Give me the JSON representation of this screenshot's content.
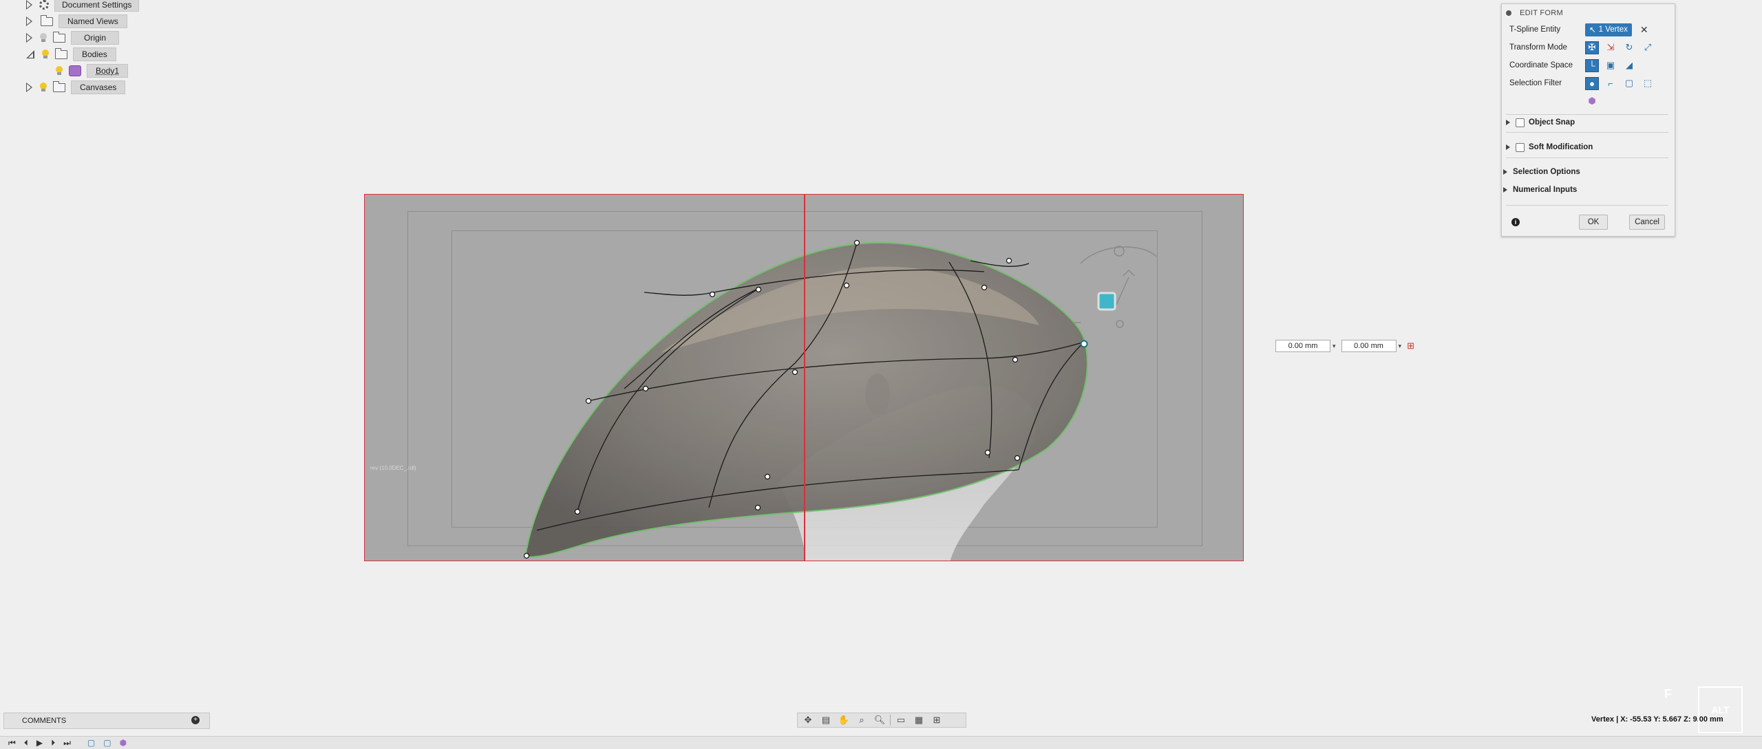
{
  "browser_tree": {
    "items": [
      {
        "label": "Document Settings",
        "icon": "gear-icon",
        "expanded": false
      },
      {
        "label": "Named Views",
        "icon": "folder-icon",
        "expanded": false
      },
      {
        "label": "Origin",
        "icon": "folder-icon",
        "expanded": false
      },
      {
        "label": "Bodies",
        "icon": "folder-icon",
        "expanded": true
      },
      {
        "label": "Body1",
        "icon": "body-icon",
        "expanded": false
      },
      {
        "label": "Canvases",
        "icon": "folder-icon",
        "expanded": false
      }
    ]
  },
  "canvas": {
    "label": "rev (10.0DEC_.rdl)"
  },
  "edit_form": {
    "title": "EDIT FORM",
    "tspline_entity_label": "T-Spline Entity",
    "tspline_entity_value": "1 Vertex",
    "transform_mode_label": "Transform Mode",
    "coordinate_space_label": "Coordinate Space",
    "selection_filter_label": "Selection Filter",
    "object_snap_label": "Object Snap",
    "soft_modification_label": "Soft Modification",
    "selection_options_label": "Selection Options",
    "numerical_inputs_label": "Numerical Inputs",
    "ok_label": "OK",
    "cancel_label": "Cancel",
    "accent_color": "#2f78b8"
  },
  "numeric_inputs": {
    "value1": "0.00 mm",
    "value2": "0.00 mm"
  },
  "comments": {
    "label": "COMMENTS"
  },
  "status": {
    "text": "Vertex | X: -55.53 Y: 5.667 Z: 9.00 mm"
  },
  "overlay": {
    "alt": "ALT",
    "f": "F"
  }
}
